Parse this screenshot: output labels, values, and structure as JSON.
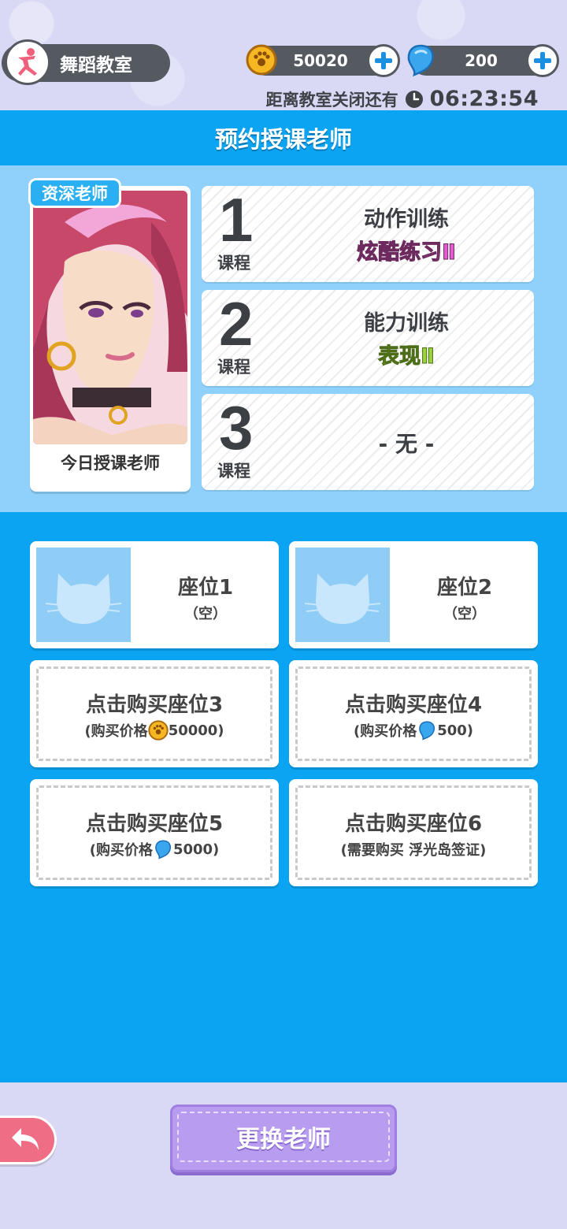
{
  "header": {
    "title": "舞蹈教室",
    "coins": "50020",
    "gems": "200",
    "countdown_label": "距离教室关闭还有",
    "countdown_time": "06:23:54"
  },
  "panel": {
    "title": "预约授课老师"
  },
  "teacher": {
    "badge": "资深老师",
    "caption": "今日授课老师"
  },
  "courses": [
    {
      "num": "1",
      "tag": "课程",
      "name": "动作训练",
      "sub": "炫酷练习Ⅱ",
      "sub_color": "#e65ad6"
    },
    {
      "num": "2",
      "tag": "课程",
      "name": "能力训练",
      "sub": "表现Ⅱ",
      "sub_color": "#9bd43a"
    },
    {
      "num": "3",
      "tag": "课程",
      "none": "- 无 -"
    }
  ],
  "seats": [
    {
      "name": "座位1",
      "state": "（空）"
    },
    {
      "name": "座位2",
      "state": "（空）"
    }
  ],
  "buy_seats": [
    {
      "title": "点击购买座位3",
      "prefix": "(购买价格",
      "icon": "coin-icon",
      "price": "50000)"
    },
    {
      "title": "点击购买座位4",
      "prefix": "(购买价格",
      "icon": "gem-icon",
      "price": "500)"
    },
    {
      "title": "点击购买座位5",
      "prefix": "(购买价格",
      "icon": "gem-icon",
      "price": "5000)"
    },
    {
      "title": "点击购买座位6",
      "prefix": "(需要购买 浮光岛签证)",
      "icon": "",
      "price": ""
    }
  ],
  "footer": {
    "change_label": "更换老师"
  }
}
